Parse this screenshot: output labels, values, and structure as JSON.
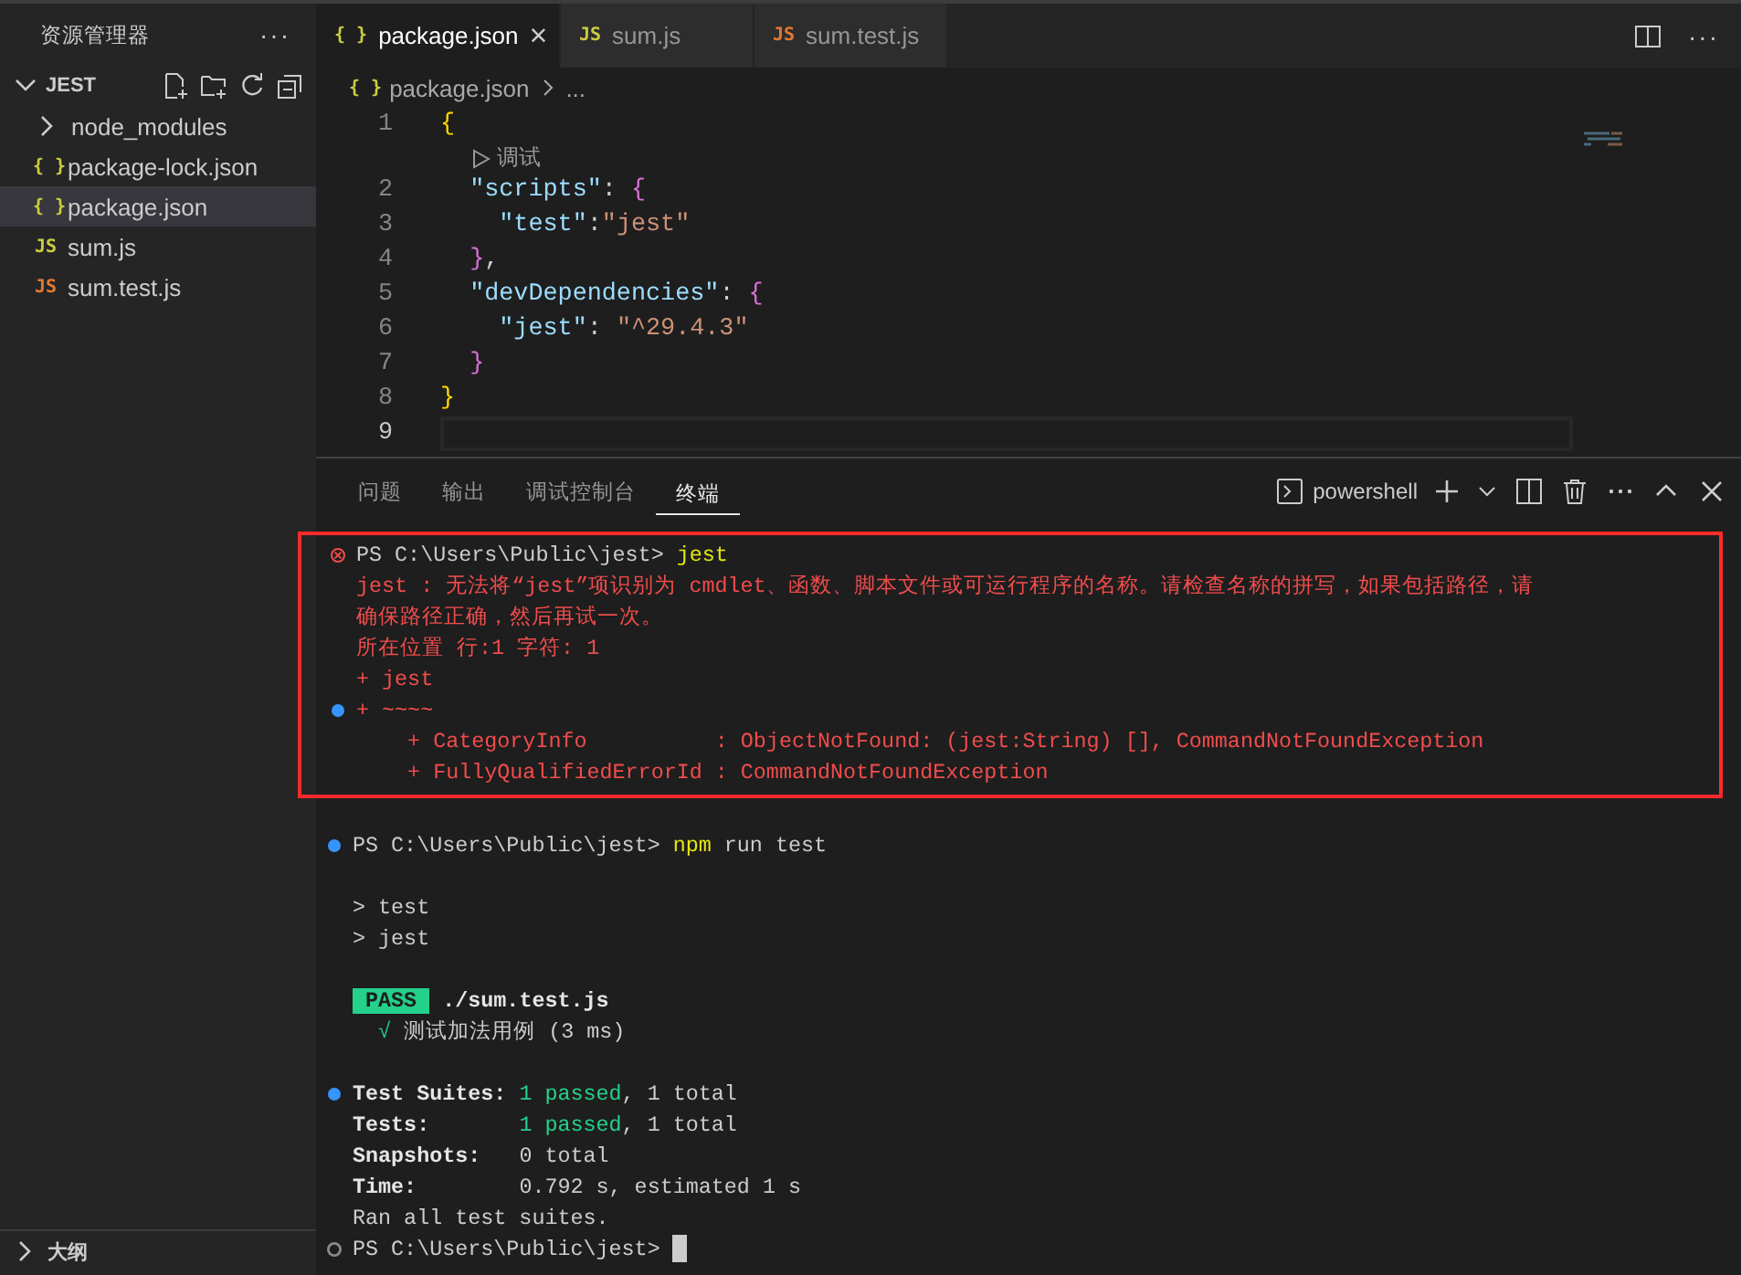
{
  "sidebar": {
    "title": "资源管理器",
    "more": "···",
    "section": {
      "label": "JEST",
      "expanded": true
    },
    "items": [
      {
        "label": "node_modules",
        "kind": "folder",
        "expanded": false,
        "selected": false
      },
      {
        "label": "package-lock.json",
        "kind": "json",
        "icon": "{ }",
        "selected": false
      },
      {
        "label": "package.json",
        "kind": "json",
        "icon": "{ }",
        "selected": true
      },
      {
        "label": "sum.js",
        "kind": "js",
        "icon": "JS",
        "selected": false
      },
      {
        "label": "sum.test.js",
        "kind": "test",
        "icon": "JS",
        "selected": false
      }
    ],
    "outline": {
      "label": "大纲",
      "expanded": false
    }
  },
  "editor": {
    "tabs": [
      {
        "label": "package.json",
        "kind": "json",
        "icon": "{ }",
        "selected": true,
        "close": "×"
      },
      {
        "label": "sum.js",
        "kind": "js",
        "icon": "JS",
        "selected": false
      },
      {
        "label": "sum.test.js",
        "kind": "test",
        "icon": "JS",
        "selected": false
      }
    ],
    "more": "···",
    "breadcrumb": {
      "icon": "{ }",
      "file": "package.json",
      "rest": "..."
    },
    "lines": [
      {
        "number": "1",
        "current": false,
        "tokens": [
          {
            "kind": "bracket1",
            "text": "{"
          }
        ]
      },
      {
        "kind": "codelens",
        "label": "调试"
      },
      {
        "number": "2",
        "current": false,
        "tokens": [
          {
            "kind": "key",
            "text": "  \"scripts\""
          },
          {
            "kind": "punct",
            "text": ": "
          },
          {
            "kind": "bracket2",
            "text": "{"
          }
        ]
      },
      {
        "number": "3",
        "current": false,
        "tokens": [
          {
            "kind": "key",
            "text": "    \"test\""
          },
          {
            "kind": "punct",
            "text": ":"
          },
          {
            "kind": "string",
            "text": "\"jest\""
          }
        ]
      },
      {
        "number": "4",
        "current": false,
        "tokens": [
          {
            "kind": "bracket2",
            "text": "  }"
          },
          {
            "kind": "punct",
            "text": ","
          }
        ]
      },
      {
        "number": "5",
        "current": false,
        "tokens": [
          {
            "kind": "key",
            "text": "  \"devDependencies\""
          },
          {
            "kind": "punct",
            "text": ": "
          },
          {
            "kind": "bracket2",
            "text": "{"
          }
        ]
      },
      {
        "number": "6",
        "current": false,
        "tokens": [
          {
            "kind": "key",
            "text": "    \"jest\""
          },
          {
            "kind": "punct",
            "text": ": "
          },
          {
            "kind": "string",
            "text": "\"^29.4.3\""
          }
        ]
      },
      {
        "number": "7",
        "current": false,
        "tokens": [
          {
            "kind": "bracket2",
            "text": "  }"
          }
        ]
      },
      {
        "number": "8",
        "current": false,
        "tokens": [
          {
            "kind": "bracket1",
            "text": "}"
          }
        ]
      },
      {
        "number": "9",
        "current": true
      }
    ]
  },
  "panel": {
    "tabs": [
      {
        "label": "问题",
        "selected": false
      },
      {
        "label": "输出",
        "selected": false
      },
      {
        "label": "调试控制台",
        "selected": false
      },
      {
        "label": "终端",
        "selected": true
      }
    ],
    "shell": "powershell",
    "terminal": {
      "highlighted_block": [
        {
          "gutter": {
            "kind": "error"
          },
          "segments": [
            {
              "kind": "plain",
              "text": "PS C:\\Users\\Public\\jest> "
            },
            {
              "kind": "command",
              "text": "jest"
            }
          ]
        },
        {
          "segments": [
            {
              "kind": "error",
              "text": "jest : 无法将“jest”项识别为 cmdlet、函数、脚本文件或可运行程序的名称。请检查名称的拼写，如果包括路径，请"
            }
          ]
        },
        {
          "segments": [
            {
              "kind": "error",
              "text": "确保路径正确，然后再试一次。"
            }
          ]
        },
        {
          "segments": [
            {
              "kind": "error",
              "text": "所在位置 行:1 字符: 1"
            }
          ]
        },
        {
          "segments": [
            {
              "kind": "error",
              "text": "+ jest"
            }
          ]
        },
        {
          "gutter": {
            "kind": "info"
          },
          "segments": [
            {
              "kind": "error",
              "text": "+ ~~~~"
            }
          ]
        },
        {
          "segments": [
            {
              "kind": "error",
              "text": "    + CategoryInfo          : ObjectNotFound: (jest:String) [], CommandNotFoundException"
            }
          ]
        },
        {
          "segments": [
            {
              "kind": "error",
              "text": "    + FullyQualifiedErrorId : CommandNotFoundException"
            }
          ]
        }
      ],
      "lines": [
        {
          "kind": "blank"
        },
        {
          "gutter": {
            "kind": "info"
          },
          "segments": [
            {
              "kind": "plain",
              "text": "PS C:\\Users\\Public\\jest> "
            },
            {
              "kind": "command",
              "text": "npm"
            },
            {
              "kind": "plain",
              "text": " run test"
            }
          ]
        },
        {
          "kind": "blank"
        },
        {
          "segments": [
            {
              "kind": "plain",
              "text": "> test"
            }
          ]
        },
        {
          "segments": [
            {
              "kind": "plain",
              "text": "> jest"
            }
          ]
        },
        {
          "kind": "blank"
        },
        {
          "segments": [
            {
              "kind": "badge",
              "text": " PASS "
            },
            {
              "kind": "bold",
              "text": " ./sum.test.js"
            }
          ]
        },
        {
          "segments": [
            {
              "kind": "success",
              "text": "  √"
            },
            {
              "kind": "plain",
              "text": " 测试加法用例 (3 ms)"
            }
          ]
        },
        {
          "kind": "blank"
        },
        {
          "gutter": {
            "kind": "info"
          },
          "segments": [
            {
              "kind": "bold",
              "text": "Test Suites: "
            },
            {
              "kind": "success",
              "text": "1 passed"
            },
            {
              "kind": "plain",
              "text": ", 1 total"
            }
          ]
        },
        {
          "segments": [
            {
              "kind": "bold",
              "text": "Tests:       "
            },
            {
              "kind": "success",
              "text": "1 passed"
            },
            {
              "kind": "plain",
              "text": ", 1 total"
            }
          ]
        },
        {
          "segments": [
            {
              "kind": "bold",
              "text": "Snapshots:   "
            },
            {
              "kind": "plain",
              "text": "0 total"
            }
          ]
        },
        {
          "segments": [
            {
              "kind": "bold",
              "text": "Time:        "
            },
            {
              "kind": "plain",
              "text": "0.792 s, estimated 1 s"
            }
          ]
        },
        {
          "segments": [
            {
              "kind": "plain",
              "text": "Ran all test suites."
            }
          ]
        },
        {
          "gutter": {
            "kind": "idle"
          },
          "cursor": true,
          "segments": [
            {
              "kind": "plain",
              "text": "PS C:\\Users\\Public\\jest> "
            }
          ]
        }
      ]
    }
  }
}
